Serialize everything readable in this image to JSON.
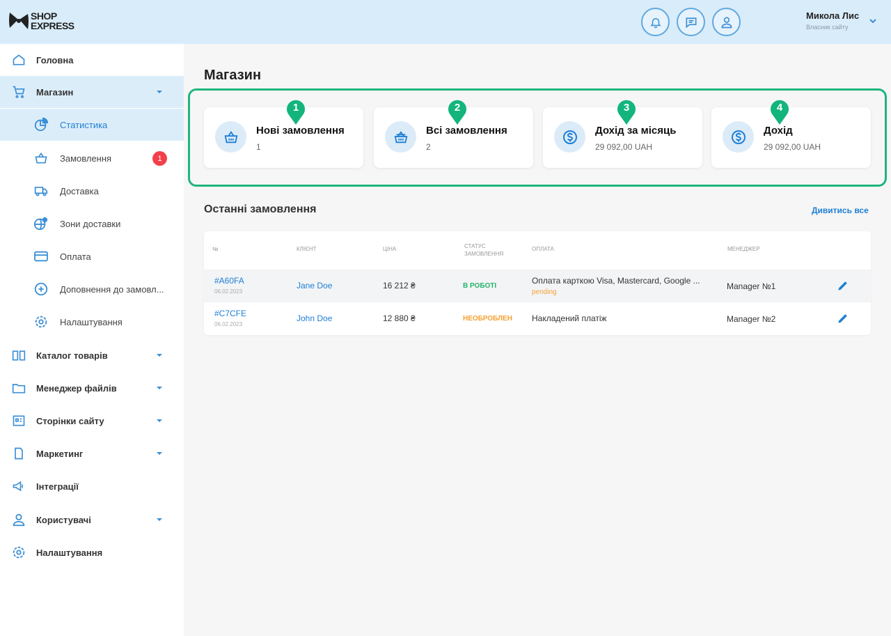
{
  "brand": {
    "line1": "SHOP",
    "line2": "EXPRESS"
  },
  "header": {
    "user_name": "Микола Лис",
    "user_role": "Власник сайту"
  },
  "sidebar": {
    "items": [
      {
        "label": "Головна"
      },
      {
        "label": "Магазин"
      },
      {
        "label": "Статистика"
      },
      {
        "label": "Замовлення",
        "badge": "1"
      },
      {
        "label": "Доставка"
      },
      {
        "label": "Зони доставки"
      },
      {
        "label": "Оплата"
      },
      {
        "label": "Доповнення до замовл..."
      },
      {
        "label": "Налаштування"
      },
      {
        "label": "Каталог товарів"
      },
      {
        "label": "Менеджер файлів"
      },
      {
        "label": "Сторінки сайту"
      },
      {
        "label": "Маркетинг"
      },
      {
        "label": "Інтеграції"
      },
      {
        "label": "Користувачі"
      },
      {
        "label": "Налаштування"
      }
    ]
  },
  "main": {
    "title": "Магазин",
    "cards": [
      {
        "marker": "1",
        "title": "Нові замовлення",
        "value": "1"
      },
      {
        "marker": "2",
        "title": "Всі замовлення",
        "value": "2"
      },
      {
        "marker": "3",
        "title": "Дохід за місяць",
        "value": "29 092,00 UAH"
      },
      {
        "marker": "4",
        "title": "Дохід",
        "value": "29 092,00 UAH"
      }
    ],
    "recent_title": "Останні замовлення",
    "see_all": "Дивитись все",
    "table": {
      "headers": [
        "№",
        "Клієнт",
        "Ціна",
        "Статус замовлення",
        "Оплата",
        "Менеджер"
      ],
      "rows": [
        {
          "id": "#A60FA",
          "date": "06.02.2023",
          "client": "Jane Doe",
          "price": "16 212 ₴",
          "status": "В роботі",
          "payment": "Оплата карткою Visa, Mastercard, Google ...",
          "payment_status": "pending",
          "manager": "Manager №1"
        },
        {
          "id": "#C7CFE",
          "date": "06.02.2023",
          "client": "John Doe",
          "price": "12 880 ₴",
          "status": "Необроблен",
          "payment": "Накладений платіж",
          "payment_status": "",
          "manager": "Manager №2"
        }
      ]
    }
  },
  "colors": {
    "accent": "#1e7fd4",
    "highlight": "#1fb57e",
    "topbar": "#d9ecf9",
    "badge": "#f2404a"
  }
}
